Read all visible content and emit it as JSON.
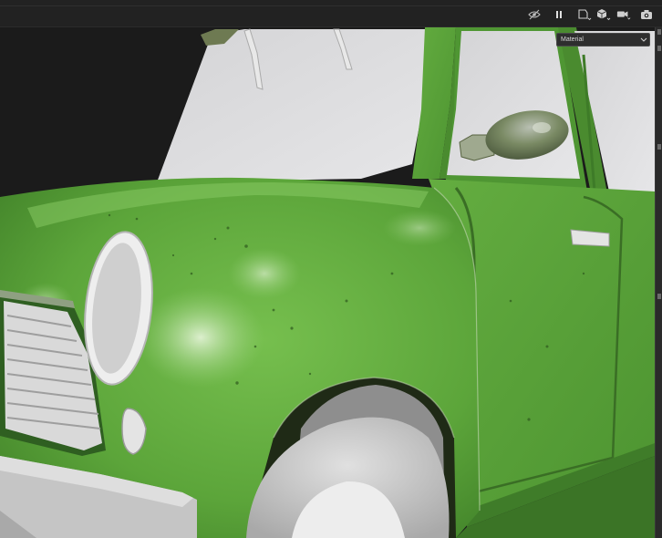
{
  "toolbar": {
    "icons": [
      "hide-ui-icon",
      "pause-icon",
      "view-mode-icon",
      "display-icon",
      "camera-icon",
      "screenshot-icon"
    ]
  },
  "viewport": {
    "channel_selector": {
      "selected": "Material"
    },
    "scene": "car-model"
  },
  "colors": {
    "background": "#1e1e1e",
    "toolbar": "#222222",
    "car_paint": "#5da33a",
    "rubber": "#c9c9c9"
  }
}
